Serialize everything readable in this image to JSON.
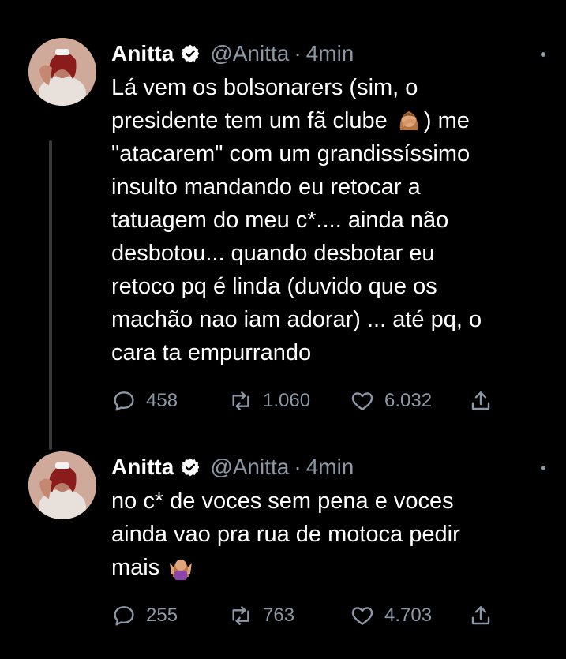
{
  "tweets": [
    {
      "name": "Anitta",
      "handle": "@Anitta",
      "dot": "·",
      "time": "4min",
      "text_before_emoji": "Lá vem os bolsonarers (sim, o\npresidente tem um fã clube ",
      "emoji": "facepalm-emoji",
      "text_after_emoji": ") me\n\"atacarem\" com um grandissíssimo\ninsulto mandando eu retocar a\ntatuagem do meu c*.... ainda não\ndesbotou... quando desbotar eu\nretoco pq é linda (duvido que os\nmachão nao iam adorar) ... até pq, o\ncara ta empurrando",
      "replies": "458",
      "retweets": "1.060",
      "likes": "6.032"
    },
    {
      "name": "Anitta",
      "handle": "@Anitta",
      "dot": "·",
      "time": "4min",
      "text_before_emoji": "no c* de voces sem pena e voces\nainda vao pra rua de motoca pedir\nmais ",
      "emoji": "shrug-emoji",
      "text_after_emoji": "",
      "replies": "255",
      "retweets": "763",
      "likes": "4.703"
    }
  ],
  "colors": {
    "background": "#000000",
    "text": "#ffffff",
    "secondary": "#8b98a5"
  }
}
